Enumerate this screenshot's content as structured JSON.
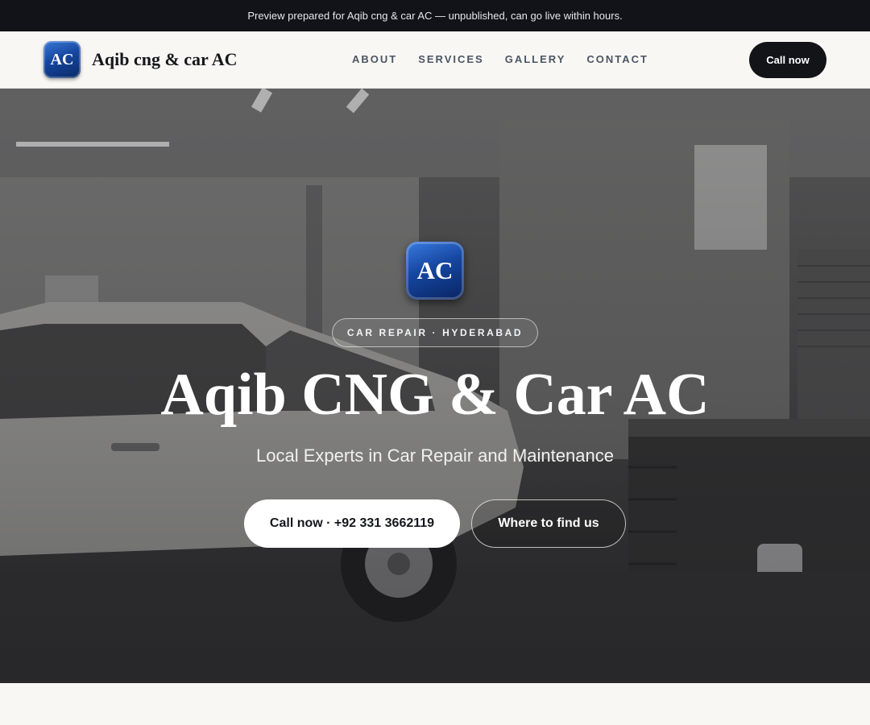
{
  "preview_bar": {
    "text": "Preview prepared for Aqib cng & car AC — unpublished, can go live within hours."
  },
  "header": {
    "logo_text": "AC",
    "brand_name": "Aqib cng & car AC",
    "nav": [
      "ABOUT",
      "SERVICES",
      "GALLERY",
      "CONTACT"
    ],
    "cta_label": "Call now"
  },
  "hero": {
    "logo_text": "AC",
    "tagline": "CAR REPAIR · HYDERABAD",
    "title": "Aqib CNG & Car AC",
    "subtitle": "Local Experts in Car Repair and Maintenance",
    "primary_button": "Call now · +92 331 3662119",
    "secondary_button": "Where to find us"
  },
  "colors": {
    "dark": "#111318",
    "logo_blue": "#1546a0",
    "page_bg": "#f8f7f4"
  }
}
